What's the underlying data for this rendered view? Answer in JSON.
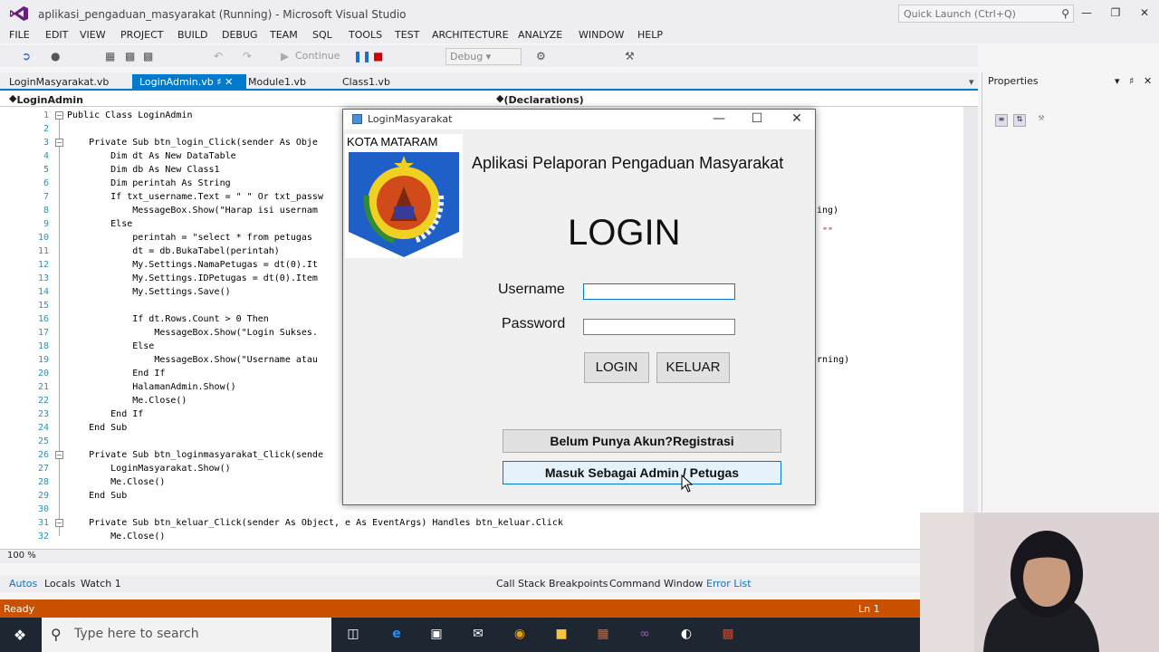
{
  "window": {
    "title": "aplikasi_pengaduan_masyarakat (Running) - Microsoft Visual Studio",
    "quick_launch": "Quick Launch (Ctrl+Q)"
  },
  "menu": [
    "FILE",
    "EDIT",
    "VIEW",
    "PROJECT",
    "BUILD",
    "DEBUG",
    "TEAM",
    "SQL",
    "TOOLS",
    "TEST",
    "ARCHITECTURE",
    "ANALYZE",
    "WINDOW",
    "HELP"
  ],
  "toolbar": {
    "continue_label": "Continue",
    "config": "Debug"
  },
  "tabs": [
    {
      "label": "LoginMasyarakat.vb",
      "active": false
    },
    {
      "label": "LoginAdmin.vb",
      "active": true
    },
    {
      "label": "Module1.vb",
      "active": false
    },
    {
      "label": "Class1.vb",
      "active": false
    }
  ],
  "navbar": {
    "left": "LoginAdmin",
    "right": "(Declarations)"
  },
  "code": {
    "line_numbers": [
      "1",
      "2",
      "3",
      "4",
      "5",
      "6",
      "7",
      "8",
      "9",
      "10",
      "11",
      "12",
      "13",
      "14",
      "15",
      "16",
      "17",
      "18",
      "19",
      "20",
      "21",
      "22",
      "23",
      "24",
      "25",
      "26",
      "27",
      "28",
      "29",
      "30",
      "31",
      "32"
    ],
    "lines": [
      "Public Class LoginAdmin",
      "",
      "    Private Sub btn_login_Click(sender As Obje",
      "        Dim dt As New DataTable",
      "        Dim db As New Class1",
      "        Dim perintah As String",
      "        If txt_username.Text = \" \" Or txt_passw",
      "            MessageBox.Show(\"Harap isi usernam",
      "        Else",
      "            perintah = \"select * from petugas ",
      "            dt = db.BukaTabel(perintah)",
      "            My.Settings.NamaPetugas = dt(0).It",
      "            My.Settings.IDPetugas = dt(0).Item",
      "            My.Settings.Save()",
      "",
      "            If dt.Rows.Count > 0 Then",
      "                MessageBox.Show(\"Login Sukses.",
      "            Else",
      "                MessageBox.Show(\"Username atau",
      "            End If",
      "            HalamanAdmin.Show()",
      "            Me.Close()",
      "        End If",
      "    End Sub",
      "",
      "    Private Sub btn_loginmasyarakat_Click(sende",
      "        LoginMasyarakat.Show()",
      "        Me.Close()",
      "    End Sub",
      "",
      "    Private Sub btn_keluar_Click(sender As Object, e As EventArgs) Handles btn_keluar.Click",
      "        Me.Close()"
    ],
    "right_fragments": [
      "ing)",
      "\"\"",
      "rning)"
    ]
  },
  "zoom": "100 %",
  "properties": {
    "title": "Properties"
  },
  "bottom_tabs": [
    "Autos",
    "Locals",
    "Watch 1",
    "Call Stack",
    "Breakpoints",
    "Command Window",
    "Error List"
  ],
  "status": {
    "left": "Ready",
    "right": "Ln 1"
  },
  "taskbar": {
    "search_placeholder": "Type here to search"
  },
  "dialog": {
    "title": "LoginMasyarakat",
    "logo_caption": "KOTA MATARAM",
    "app_title": "Aplikasi Pelaporan Pengaduan Masyarakat",
    "heading": "LOGIN",
    "username_label": "Username",
    "password_label": "Password",
    "username_value": "",
    "password_value": "",
    "login_button": "LOGIN",
    "exit_button": "KELUAR",
    "register_button": "Belum Punya Akun?Registrasi",
    "admin_button": "Masuk Sebagai Admin / Petugas"
  },
  "colors": {
    "accent": "#007acc",
    "status_bar": "#ca5100",
    "keyword": "#0000ff",
    "type": "#2b91af",
    "string": "#a31515"
  }
}
